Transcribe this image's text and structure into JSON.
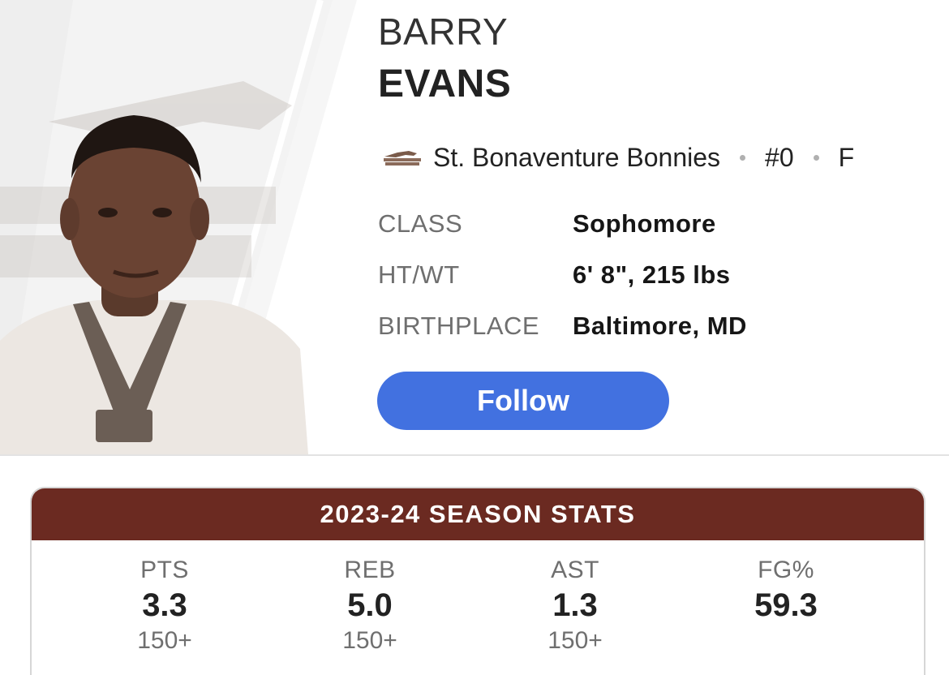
{
  "player": {
    "first_name": "BARRY",
    "last_name": "EVANS"
  },
  "team": {
    "name": "St. Bonaventure Bonnies",
    "number": "#0",
    "position": "F",
    "logo_icon": "bonnies-logo-icon",
    "brand_color": "#6b2a21"
  },
  "bio": [
    {
      "label": "CLASS",
      "value": "Sophomore"
    },
    {
      "label": "HT/WT",
      "value": "6' 8\", 215 lbs"
    },
    {
      "label": "BIRTHPLACE",
      "value": "Baltimore, MD"
    }
  ],
  "follow": {
    "label": "Follow",
    "color": "#4271e0"
  },
  "season_stats": {
    "title": "2023-24 SEASON STATS",
    "stats": [
      {
        "label": "PTS",
        "value": "3.3",
        "rank": "150+"
      },
      {
        "label": "REB",
        "value": "5.0",
        "rank": "150+"
      },
      {
        "label": "AST",
        "value": "1.3",
        "rank": "150+"
      },
      {
        "label": "FG%",
        "value": "59.3",
        "rank": ""
      }
    ]
  }
}
